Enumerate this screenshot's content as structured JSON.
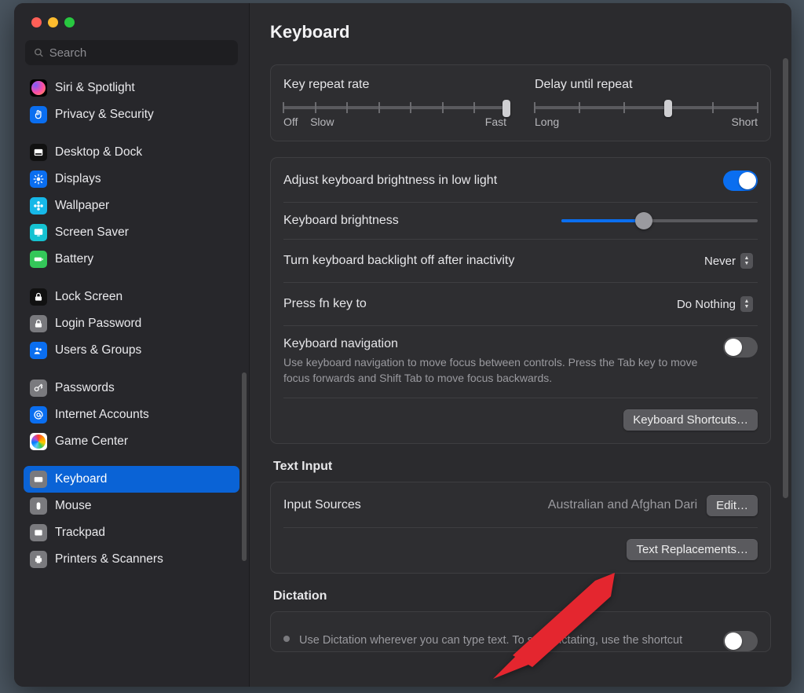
{
  "search": {
    "placeholder": "Search"
  },
  "pageTitle": "Keyboard",
  "sidebar": {
    "groups": [
      {
        "items": [
          {
            "label": "Siri & Spotlight",
            "icon": "siri",
            "bg": "#000"
          },
          {
            "label": "Privacy & Security",
            "icon": "hand",
            "bg": "#0a6ef0"
          }
        ]
      },
      {
        "items": [
          {
            "label": "Desktop & Dock",
            "icon": "dock",
            "bg": "#111"
          },
          {
            "label": "Displays",
            "icon": "sun",
            "bg": "#0a6ef0"
          },
          {
            "label": "Wallpaper",
            "icon": "flower",
            "bg": "#16b8e8"
          },
          {
            "label": "Screen Saver",
            "icon": "screen",
            "bg": "#15c2d1"
          },
          {
            "label": "Battery",
            "icon": "battery",
            "bg": "#34c759"
          }
        ]
      },
      {
        "items": [
          {
            "label": "Lock Screen",
            "icon": "lock",
            "bg": "#111"
          },
          {
            "label": "Login Password",
            "icon": "pwlock",
            "bg": "#7a7a7e"
          },
          {
            "label": "Users & Groups",
            "icon": "users",
            "bg": "#0a6ef0"
          }
        ]
      },
      {
        "items": [
          {
            "label": "Passwords",
            "icon": "key",
            "bg": "#7a7a7e"
          },
          {
            "label": "Internet Accounts",
            "icon": "at",
            "bg": "#0a6ef0"
          },
          {
            "label": "Game Center",
            "icon": "game",
            "bg": "#fff"
          }
        ]
      },
      {
        "items": [
          {
            "label": "Keyboard",
            "icon": "keyboard",
            "bg": "#7a7a7e",
            "selected": true
          },
          {
            "label": "Mouse",
            "icon": "mouse",
            "bg": "#7a7a7e"
          },
          {
            "label": "Trackpad",
            "icon": "trackpad",
            "bg": "#7a7a7e"
          },
          {
            "label": "Printers & Scanners",
            "icon": "printer",
            "bg": "#7a7a7e"
          }
        ]
      }
    ]
  },
  "repeat": {
    "rateLabel": "Key repeat rate",
    "delayLabel": "Delay until repeat",
    "offLabel": "Off",
    "slowLabel": "Slow",
    "fastLabel": "Fast",
    "longLabel": "Long",
    "shortLabel": "Short",
    "rateTicks": 8,
    "ratePosition": 7,
    "delayTicks": 6,
    "delayPosition": 3
  },
  "brightness": {
    "autoLabel": "Adjust keyboard brightness in low light",
    "autoOn": true,
    "label": "Keyboard brightness",
    "percent": 42,
    "backlightLabel": "Turn keyboard backlight off after inactivity",
    "backlightValue": "Never",
    "fnLabel": "Press fn key to",
    "fnValue": "Do Nothing",
    "navLabel": "Keyboard navigation",
    "navDesc": "Use keyboard navigation to move focus between controls. Press the Tab key to move focus forwards and Shift Tab to move focus backwards.",
    "navOn": false,
    "shortcutsBtn": "Keyboard Shortcuts…"
  },
  "textInput": {
    "title": "Text Input",
    "sourcesLabel": "Input Sources",
    "sourcesValue": "Australian and Afghan Dari",
    "editBtn": "Edit…",
    "replacementsBtn": "Text Replacements…"
  },
  "dictation": {
    "title": "Dictation",
    "desc": "Use Dictation wherever you can type text. To start dictating, use the shortcut"
  }
}
